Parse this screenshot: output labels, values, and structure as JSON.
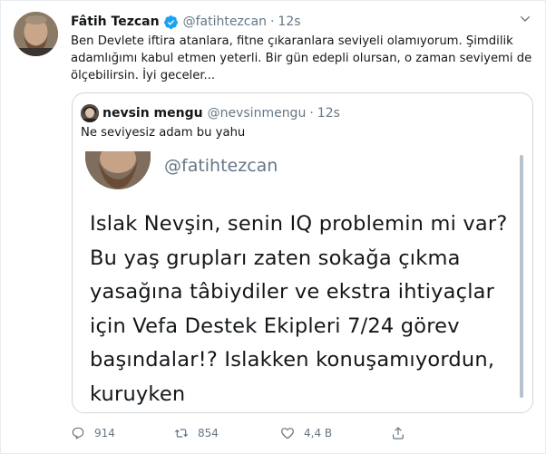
{
  "tweet": {
    "author_name": "Fâtih Tezcan",
    "author_handle": "@fatihtezcan",
    "separator": "·",
    "time": "12s",
    "text": "Ben Devlete iftira atanlara, fitne çıkaranlara seviyeli olamıyorum. Şimdilik adamlığımı kabul etmen yeterli. Bir gün edepli olursan, o zaman seviyemi de ölçebilirsin. İyi geceler...",
    "quoted": {
      "author_name": "nevsin mengu",
      "author_handle": "@nevsinmengu",
      "separator": "·",
      "time": "12s",
      "text": "Ne seviyesiz adam bu yahu",
      "media": {
        "handle": "@fatihtezcan",
        "text": "Islak Nevşin, senin IQ problemin mi var? Bu yaş grupları zaten sokağa çıkma yasağına tâbiydiler ve ekstra ihtiyaçlar için Vefa Destek Ekipleri 7/24 görev başındalar!?  Islakken konuşamıyordun, kuruyken"
      }
    },
    "actions": {
      "replies": "914",
      "retweets": "854",
      "likes": "4,4 B"
    },
    "colors": {
      "verified": "#1da1f2",
      "muted": "#657786",
      "border": "#ccd6dd"
    },
    "icons": {
      "verified": "verified-badge-icon",
      "caret": "chevron-down-icon",
      "reply": "reply-icon",
      "retweet": "retweet-icon",
      "like": "heart-icon",
      "share": "share-icon"
    }
  }
}
